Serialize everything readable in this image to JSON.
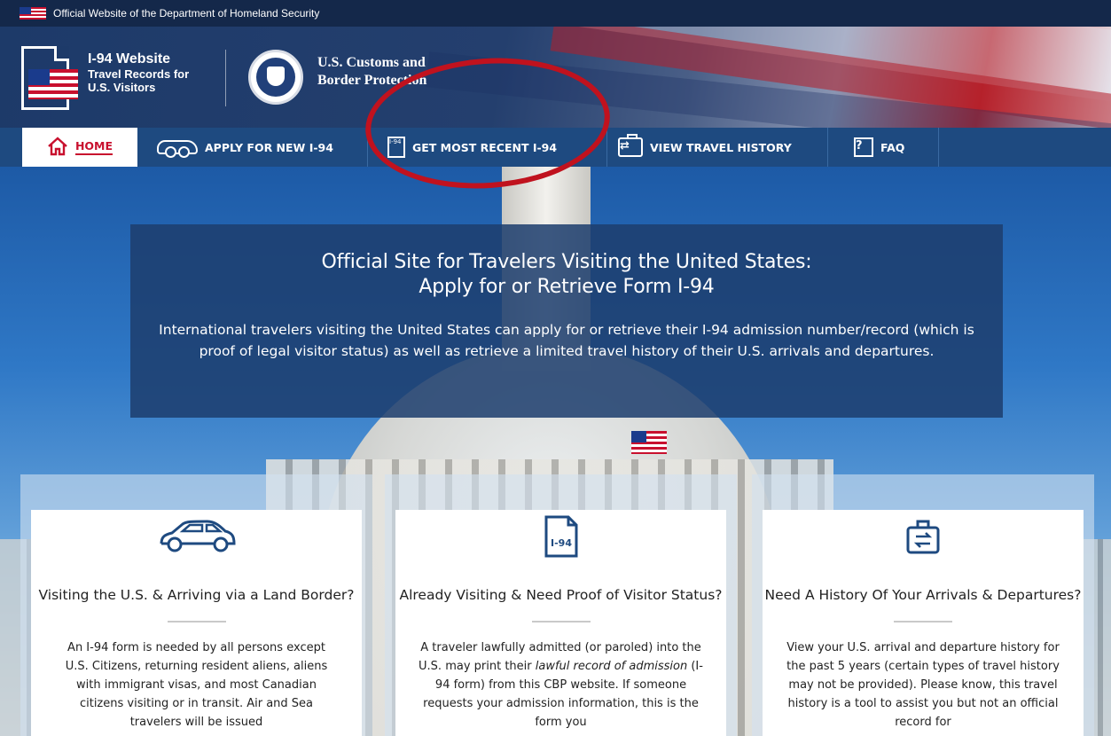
{
  "gov_banner": {
    "text": "Official Website of the Department of Homeland Security"
  },
  "header": {
    "site_title": "I-94 Website",
    "site_subtitle_line1": "Travel Records for",
    "site_subtitle_line2": "U.S. Visitors",
    "agency_line1": "U.S. Customs and",
    "agency_line2": "Border Protection"
  },
  "nav": {
    "items": [
      {
        "label": "HOME",
        "icon": "home-icon",
        "active": true
      },
      {
        "label": "APPLY FOR NEW I-94",
        "icon": "car-icon"
      },
      {
        "label": "GET MOST RECENT I-94",
        "icon": "i94-document-icon"
      },
      {
        "label": "VIEW TRAVEL HISTORY",
        "icon": "travel-bag-icon"
      },
      {
        "label": "FAQ",
        "icon": "question-icon"
      }
    ]
  },
  "intro": {
    "heading_line1": "Official Site for Travelers Visiting the United States:",
    "heading_line2": "Apply for or Retrieve Form I-94",
    "body": "International travelers visiting the United States can apply for or retrieve their I-94 admission number/record (which is proof of legal visitor status) as well as retrieve a limited travel history of their U.S. arrivals and departures."
  },
  "cards": [
    {
      "icon": "car-icon",
      "title": "Visiting the U.S. & Arriving via a Land Border?",
      "body": "An I-94 form is needed by all persons except U.S. Citizens, returning resident aliens, aliens with immigrant visas, and most Canadian citizens visiting or in transit. Air and Sea travelers will be issued"
    },
    {
      "icon": "i94-document-icon",
      "icon_text": "I-94",
      "title": "Already Visiting & Need Proof of Visitor Status?",
      "body_pre": "A traveler lawfully admitted (or paroled) into the U.S. may print their ",
      "body_em": "lawful record of admission",
      "body_post": " (I-94 form) from this CBP website. If someone requests your admission information, this is the form you"
    },
    {
      "icon": "travel-bag-icon",
      "title": "Need A History Of Your Arrivals & Departures?",
      "body": "View your U.S. arrival and departure history for the past 5 years (certain types of travel history may not be provided). Please know, this travel history is a tool to assist you but not an official record for"
    }
  ],
  "colors": {
    "banner_bg": "#14284a",
    "nav_bg": "#1e4a80",
    "accent_red": "#c8102e",
    "intro_bg": "#1d3e6e"
  }
}
